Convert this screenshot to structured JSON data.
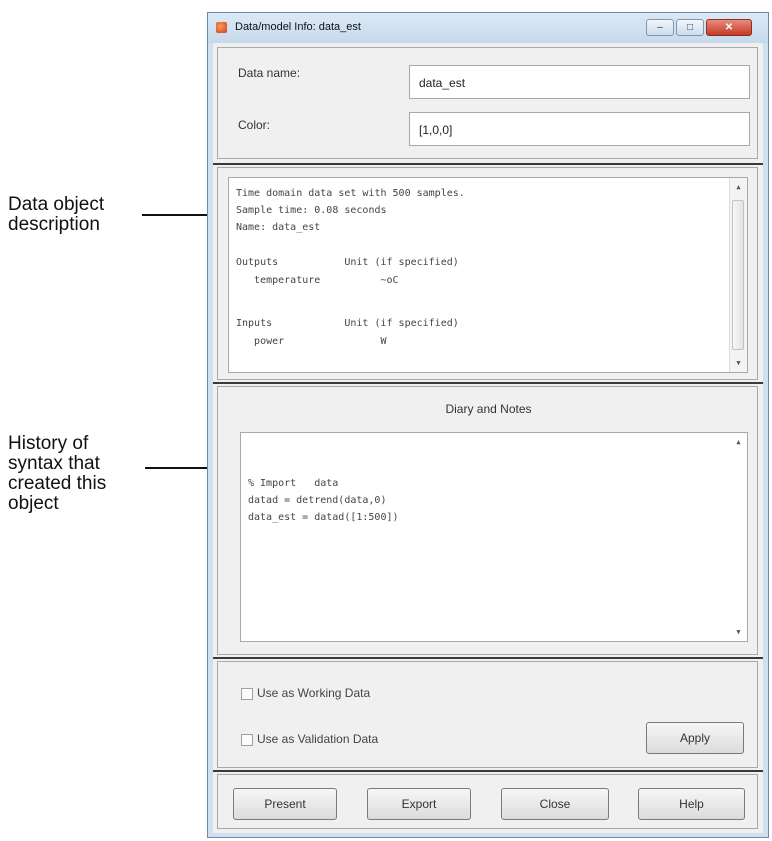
{
  "callouts": {
    "description": "Data object\ndescription",
    "history": "History of\nsyntax that\ncreated this\nobject"
  },
  "window": {
    "title": "Data/model Info: data_est",
    "controls": {
      "minimize": "–",
      "maximize": "□",
      "close": "✕"
    }
  },
  "info": {
    "data_name_label": "Data name:",
    "data_name_value": "data_est",
    "color_label": "Color:",
    "color_value": "[1,0,0]"
  },
  "description_lines": [
    "Time domain data set with 500 samples.",
    "Sample time: 0.08 seconds",
    "Name: data_est",
    "",
    "Outputs           Unit (if specified)",
    "   temperature          ~oC",
    "",
    "Inputs            Unit (if specified)",
    "   power                W"
  ],
  "diary": {
    "title": "Diary and Notes",
    "lines": [
      "% Import   data",
      "datad = detrend(data,0)",
      "data_est = datad([1:500])"
    ]
  },
  "options": {
    "working_label": "Use as Working Data",
    "validation_label": "Use as Validation Data",
    "apply_label": "Apply"
  },
  "buttons": {
    "present": "Present",
    "export": "Export",
    "close": "Close",
    "help": "Help"
  },
  "scroll": {
    "up_glyph": "▲",
    "down_glyph": "▼"
  }
}
